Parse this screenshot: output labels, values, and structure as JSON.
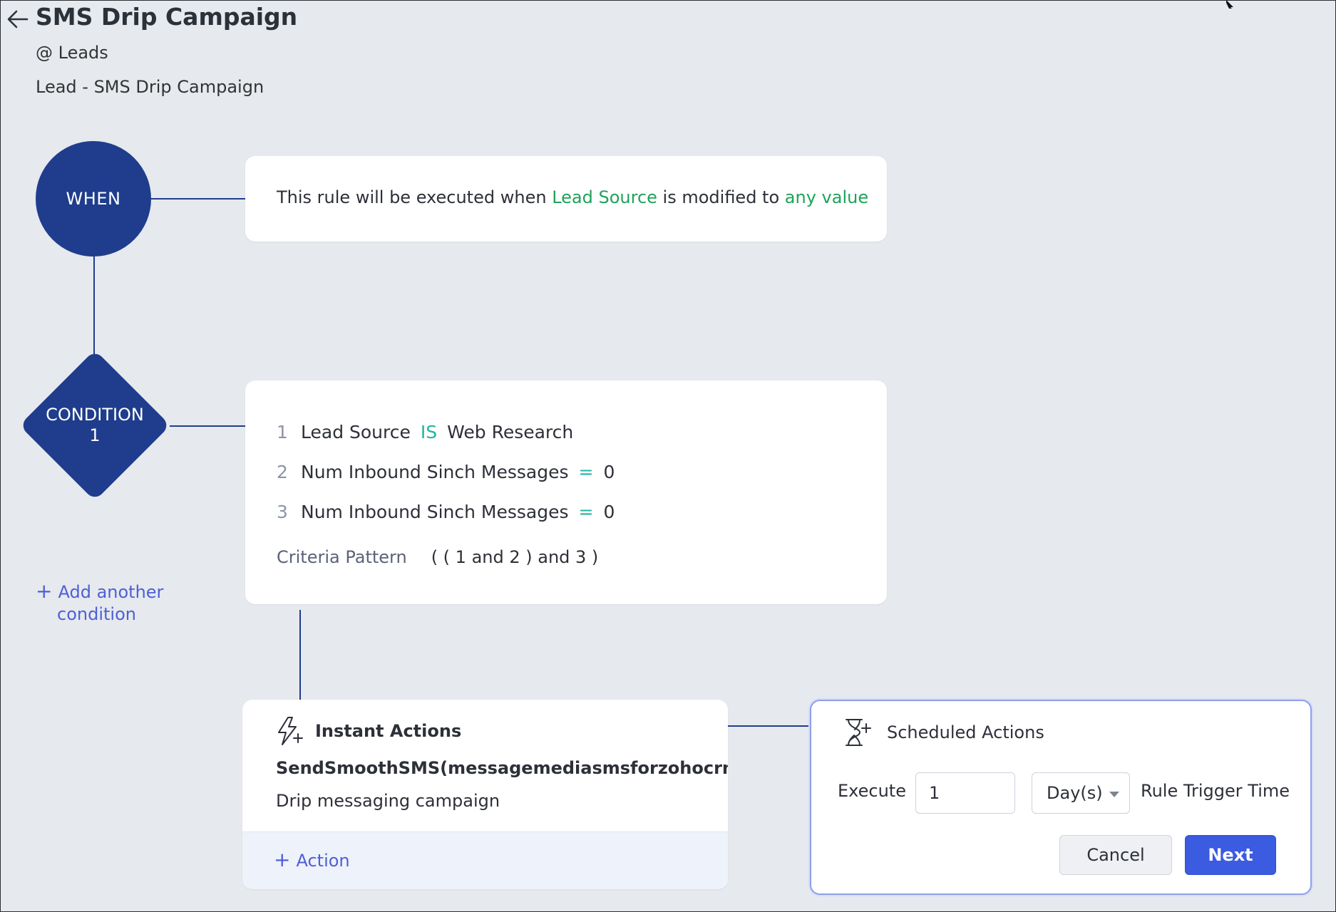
{
  "header": {
    "title": "SMS Drip Campaign",
    "module": "@ Leads",
    "rule_name": "Lead - SMS Drip Campaign"
  },
  "when": {
    "node_label": "WHEN",
    "text_prefix": "This rule will be executed when",
    "field": "Lead Source",
    "text_mid": "is modified to",
    "value": "any value"
  },
  "condition": {
    "node_label_line1": "CONDITION",
    "node_label_line2": "1",
    "rows": [
      {
        "num": "1",
        "field": "Lead Source",
        "op": "IS",
        "value": "Web Research"
      },
      {
        "num": "2",
        "field": "Num Inbound Sinch Messages",
        "op": "=",
        "value": "0"
      },
      {
        "num": "3",
        "field": "Num Inbound Sinch Messages",
        "op": "=",
        "value": "0"
      }
    ],
    "criteria_label": "Criteria Pattern",
    "criteria_value": "( ( 1 and 2 ) and 3 )"
  },
  "add_condition": {
    "plus": "+",
    "line1": "Add another",
    "line2": "condition"
  },
  "instant_actions": {
    "icon": "lightning-plus-icon",
    "title": "Instant Actions",
    "function_name": "SendSmoothSMS(messagemediasmsforzohocrm)",
    "description": "Drip messaging campaign",
    "add_action_plus": "+",
    "add_action_label": "Action"
  },
  "scheduled_actions": {
    "icon": "hourglass-plus-icon",
    "title": "Scheduled Actions",
    "execute_label": "Execute",
    "execute_value": "1",
    "unit_value": "Day(s)",
    "trigger_label": "Rule Trigger Time",
    "cancel_label": "Cancel",
    "next_label": "Next"
  },
  "colors": {
    "node_blue": "#1f3d8c",
    "accent_green": "#1ea35a",
    "operator_teal": "#20b5a0",
    "link_blue": "#4e5fd6",
    "primary_button": "#3b5be0"
  }
}
